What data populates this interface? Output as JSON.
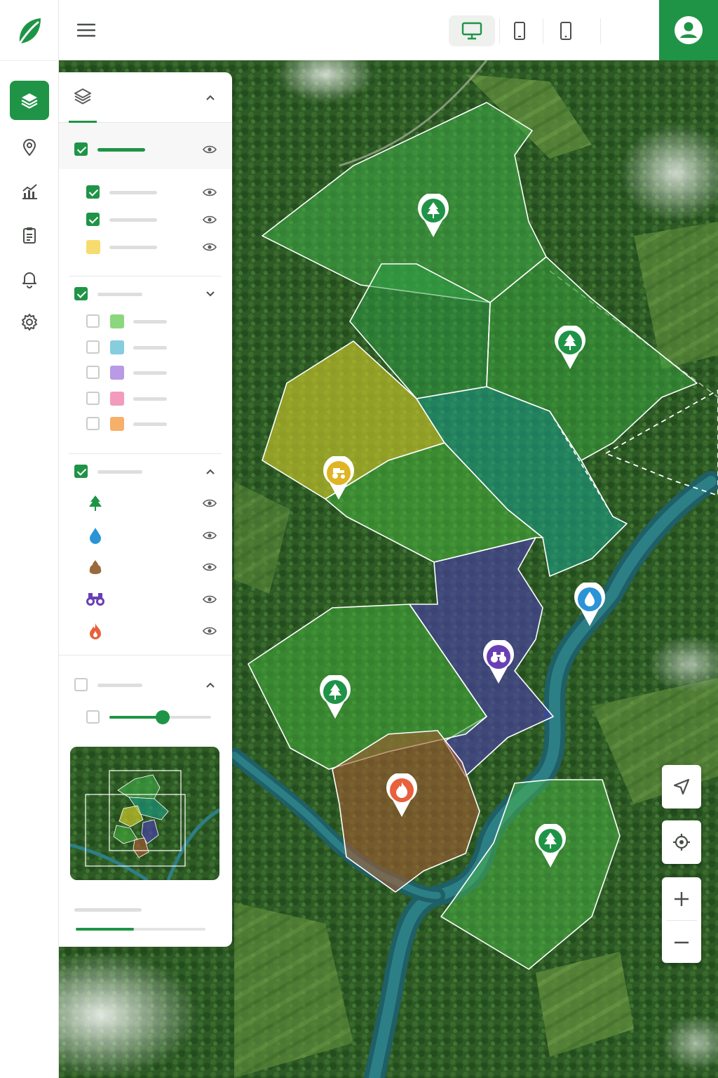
{
  "app": {
    "accent_color": "#1f9446",
    "logo_icon": "leaf-icon"
  },
  "sidebar": {
    "items": [
      {
        "icon": "layers-icon",
        "active": true
      },
      {
        "icon": "map-pin-icon",
        "active": false
      },
      {
        "icon": "analytics-chart-icon",
        "active": false
      },
      {
        "icon": "clipboard-icon",
        "active": false
      },
      {
        "icon": "bell-icon",
        "active": false
      },
      {
        "icon": "gear-icon",
        "active": false
      }
    ]
  },
  "topbar": {
    "menu_icon": "hamburger-menu-icon",
    "device_buttons": [
      {
        "icon": "desktop-icon",
        "active": true
      },
      {
        "icon": "tablet-icon",
        "active": false
      },
      {
        "icon": "mobile-icon",
        "active": false
      }
    ],
    "account_icon": "user-avatar-icon"
  },
  "layer_panel": {
    "header_icon": "layers-icon",
    "sections": [
      {
        "checked": true,
        "expanded": true,
        "items": [
          {
            "checked": true,
            "visible": true
          },
          {
            "checked": true,
            "visible": true
          },
          {
            "checked": false,
            "swatch": "#f6dc6e",
            "visible": true
          }
        ]
      },
      {
        "checked": true,
        "expanded": false,
        "items": [
          {
            "checked": false,
            "swatch": "#8bd77e"
          },
          {
            "checked": false,
            "swatch": "#86cde0"
          },
          {
            "checked": false,
            "swatch": "#b89ae6"
          },
          {
            "checked": false,
            "swatch": "#f29bbd"
          },
          {
            "checked": false,
            "swatch": "#f7b06a"
          }
        ]
      },
      {
        "checked": true,
        "expanded": true,
        "points_of_interest": [
          {
            "icon": "tree-icon",
            "color": "#1f9446",
            "visible": true
          },
          {
            "icon": "water-drop-icon",
            "color": "#2a94d6",
            "visible": true
          },
          {
            "icon": "soil-icon",
            "color": "#9a6a3c",
            "visible": true
          },
          {
            "icon": "binoculars-icon",
            "color": "#6a3fb5",
            "visible": true
          },
          {
            "icon": "fire-icon",
            "color": "#e8603c",
            "visible": true
          }
        ]
      },
      {
        "checked": false,
        "expanded": true,
        "opacity": 0.52
      }
    ],
    "progress": 0.45
  },
  "map": {
    "zones": [
      {
        "type": "forest",
        "color": "#3fae48"
      },
      {
        "type": "forest",
        "color": "#2fa048"
      },
      {
        "type": "forest",
        "color": "#3aa840"
      },
      {
        "type": "agriculture",
        "color": "#c9c62a"
      },
      {
        "type": "wetland",
        "color": "#1d9c86"
      },
      {
        "type": "forest",
        "color": "#49b43e"
      },
      {
        "type": "protected",
        "color": "#4a3fa6"
      },
      {
        "type": "forest",
        "color": "#44ad3c"
      },
      {
        "type": "burned",
        "color": "#a35a32"
      },
      {
        "type": "forest",
        "color": "#49b645"
      }
    ],
    "markers": [
      {
        "icon": "tree-icon",
        "color": "#1f9446"
      },
      {
        "icon": "tree-icon",
        "color": "#1f9446"
      },
      {
        "icon": "tractor-icon",
        "color": "#e0b422"
      },
      {
        "icon": "water-drop-icon",
        "color": "#2a94d6"
      },
      {
        "icon": "binoculars-icon",
        "color": "#6a3fb5"
      },
      {
        "icon": "tree-icon",
        "color": "#1f9446"
      },
      {
        "icon": "fire-icon",
        "color": "#e8603c"
      },
      {
        "icon": "tree-icon",
        "color": "#1f9446"
      }
    ],
    "controls": [
      "navigate-arrow-icon",
      "locate-target-icon",
      "zoom-in-icon",
      "zoom-out-icon"
    ]
  }
}
